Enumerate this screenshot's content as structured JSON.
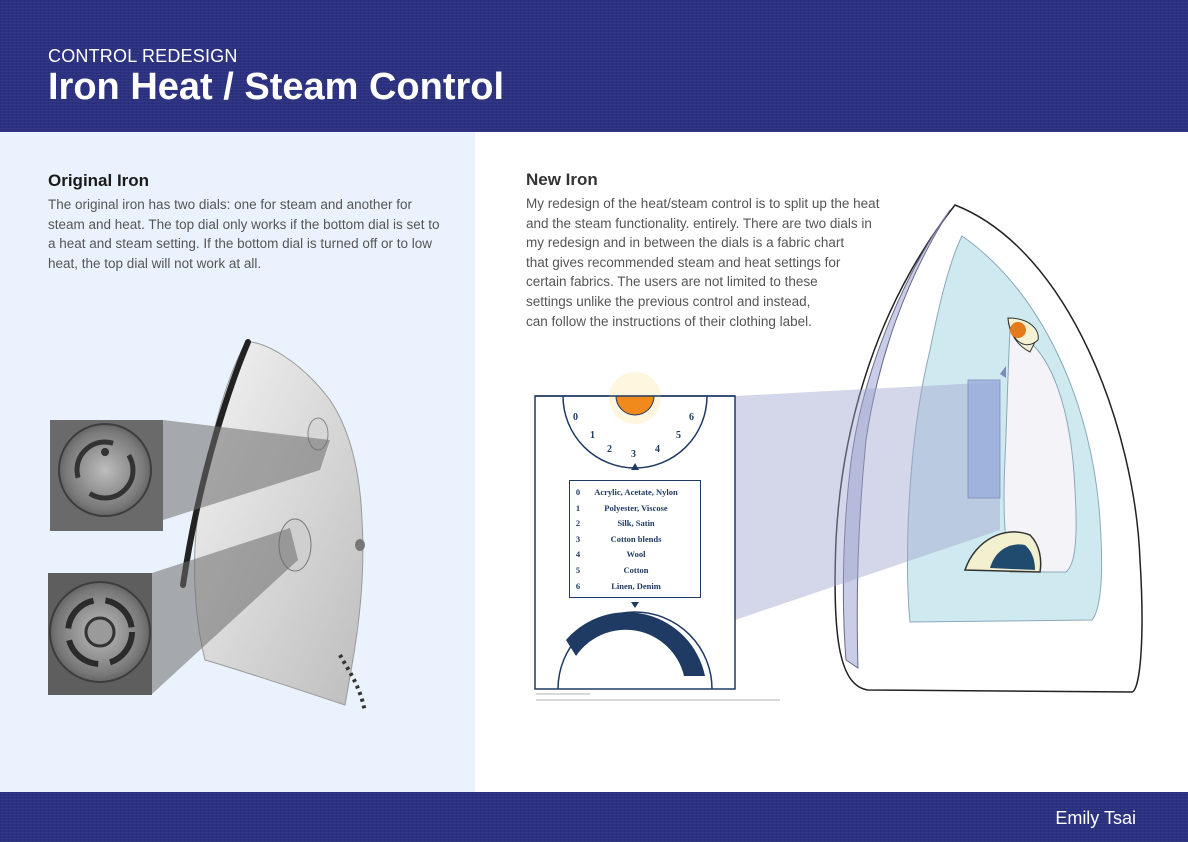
{
  "header": {
    "kicker": "CONTROL REDESIGN",
    "title": "Iron Heat / Steam Control"
  },
  "original": {
    "heading": "Original Iron",
    "body": "The original iron has two dials: one for steam and another for steam and heat. The top dial only works if the bottom dial is set to a heat and steam setting. If the bottom dial is turned off or to low heat, the top dial will not work at all."
  },
  "new_iron": {
    "heading": "New Iron",
    "body_lines": [
      "My redesign of the heat/steam control is to split up the heat",
      "and the steam functionality. entirely. There are two dials in",
      "my redesign and in between the dials is a fabric chart",
      "that gives recommended steam and heat settings for",
      "certain fabrics. The users are not limited to these",
      "settings unlike the previous control and instead,",
      "can follow the instructions of their clothing label."
    ]
  },
  "control_panel": {
    "heat_dial_ticks": [
      "0",
      "1",
      "2",
      "3",
      "4",
      "5",
      "6"
    ],
    "fabric_chart": [
      {
        "setting": "0",
        "fabric": "Acrylic, Acetate, Nylon"
      },
      {
        "setting": "1",
        "fabric": "Polyester, Viscose"
      },
      {
        "setting": "2",
        "fabric": "Silk, Satin"
      },
      {
        "setting": "3",
        "fabric": "Cotton blends"
      },
      {
        "setting": "4",
        "fabric": "Wool"
      },
      {
        "setting": "5",
        "fabric": "Cotton"
      },
      {
        "setting": "6",
        "fabric": "Linen, Denim"
      }
    ]
  },
  "footer": {
    "author": "Emily Tsai"
  },
  "colors": {
    "brand_navy": "#2b3180",
    "panel_light_blue": "#eaf2fd",
    "chart_navy": "#1f3a63",
    "heat_orange": "#f08a1c"
  }
}
